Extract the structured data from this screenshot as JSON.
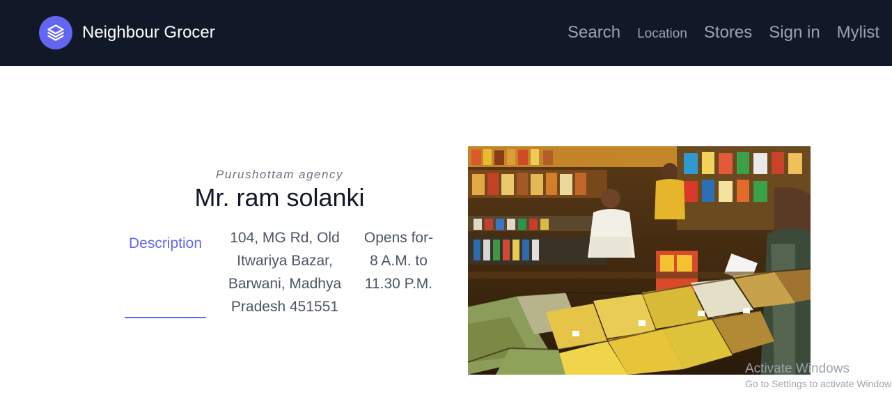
{
  "header": {
    "brand_name": "Neighbour Grocer",
    "logo_icon": "layers-icon",
    "nav": [
      {
        "label": "Search"
      },
      {
        "label": "Location"
      },
      {
        "label": "Stores"
      },
      {
        "label": "Sign in"
      },
      {
        "label": "Mylist"
      }
    ]
  },
  "store": {
    "agency": "Purushottam agency",
    "owner": "Mr. ram solanki",
    "tab_label": "Description",
    "address": "104, MG Rd, Old Itwariya Bazar, Barwani, Madhya Pradesh 451551",
    "hours": "Opens for- 8 A.M. to 11.30 P.M."
  },
  "watermark": {
    "line1": "Activate Windows",
    "line2": "Go to Settings to activate Windows."
  },
  "colors": {
    "navbar_bg": "#111827",
    "accent": "#6366f1",
    "nav_text": "#9ca3af"
  }
}
